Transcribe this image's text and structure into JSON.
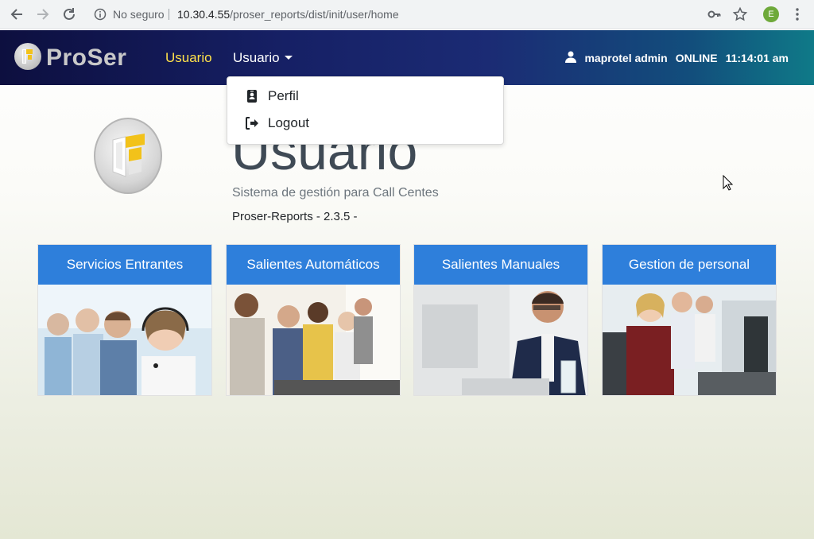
{
  "browser": {
    "security_label": "No seguro",
    "url_host": "10.30.4.55",
    "url_path": "/proser_reports/dist/init/user/home",
    "profile_initial": "E"
  },
  "navbar": {
    "brand": "ProSer",
    "links": [
      {
        "label": "Usuario",
        "active": true
      },
      {
        "label": "Usuario",
        "active": false,
        "dropdown": true
      }
    ],
    "user_name": "maprotel admin",
    "status": "ONLINE",
    "time": "11:14:01 am"
  },
  "dropdown": {
    "items": [
      {
        "label": "Perfil",
        "icon": "id-badge-icon"
      },
      {
        "label": "Logout",
        "icon": "sign-out-icon"
      }
    ]
  },
  "hero": {
    "title": "Usuario",
    "subtitle": "Sistema de gestión para Call Centes",
    "version": "Proser-Reports - 2.3.5 -"
  },
  "cards": [
    {
      "title": "Servicios Entrantes"
    },
    {
      "title": "Salientes Automáticos"
    },
    {
      "title": "Salientes Manuales"
    },
    {
      "title": "Gestion de personal"
    }
  ],
  "colors": {
    "navbar_start": "#0d0f3f",
    "navbar_end": "#0f7a88",
    "active_link": "#ffe14a",
    "card_header": "#2e7fdb"
  }
}
